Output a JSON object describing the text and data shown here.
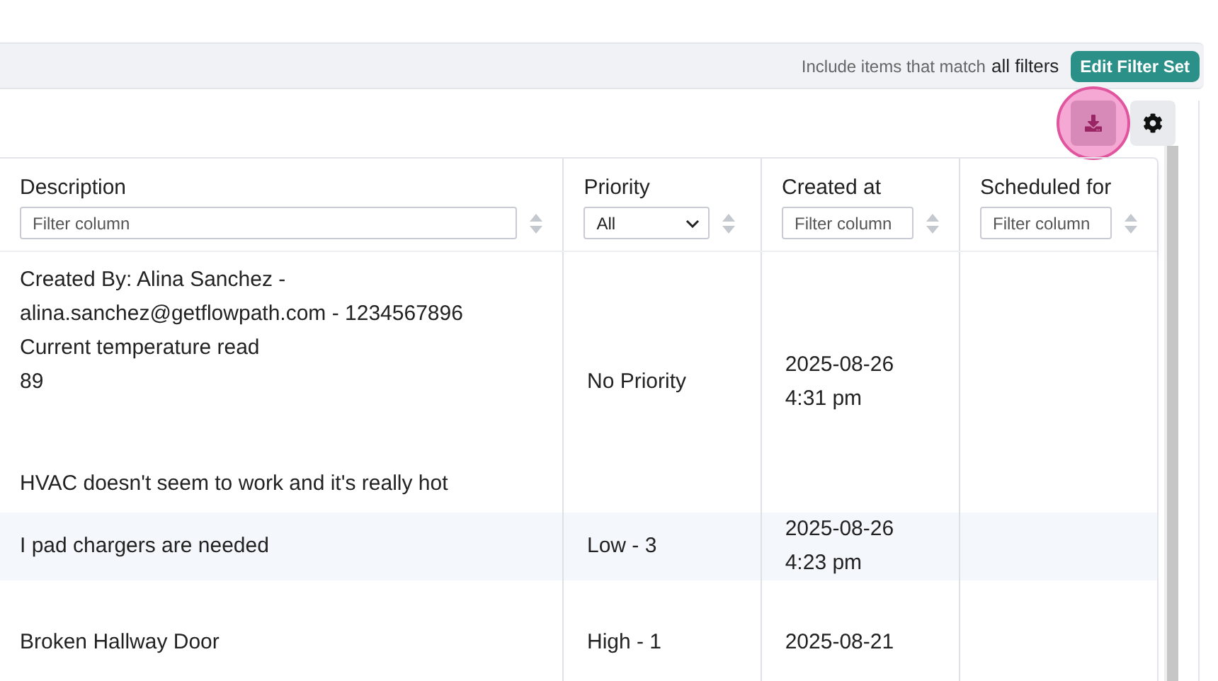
{
  "filter_bar": {
    "prefix": "Include items that match",
    "mode": "all filters",
    "button": "Edit Filter Set"
  },
  "toolbar": {
    "download_focused": true
  },
  "columns": [
    {
      "title": "Description",
      "filter": {
        "kind": "text",
        "placeholder": "Filter column"
      }
    },
    {
      "title": "Priority",
      "filter": {
        "kind": "select",
        "value": "All"
      }
    },
    {
      "title": "Created at",
      "filter": {
        "kind": "text",
        "placeholder": "Filter column"
      }
    },
    {
      "title": "Scheduled for",
      "filter": {
        "kind": "text",
        "placeholder": "Filter column"
      }
    }
  ],
  "rows": [
    {
      "description": [
        [
          "Created By: Alina Sanchez -",
          "alina.sanchez@getflowpath.com - 1234567896",
          "Current temperature read",
          "89"
        ],
        [
          "HVAC doesn't seem to work and it's really hot"
        ]
      ],
      "priority": "No Priority",
      "created_at": [
        "2025-08-26",
        "4:31 pm"
      ]
    },
    {
      "description": [
        [
          "I pad chargers are needed"
        ]
      ],
      "priority": "Low - 3",
      "created_at": [
        "2025-08-26",
        "4:23 pm"
      ]
    },
    {
      "description": [
        [
          "Broken Hallway Door"
        ]
      ],
      "priority": "High - 1",
      "created_at": [
        "2025-08-21"
      ]
    }
  ]
}
